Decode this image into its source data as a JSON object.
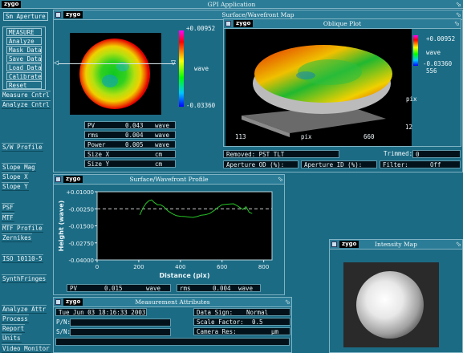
{
  "app": {
    "title": "GPI Application",
    "logo": "zygo",
    "aperture_btn": "Sm Aperture"
  },
  "measure_group": [
    "MEASURE",
    "Analyze",
    "Mask Data",
    "Save Data",
    "Load Data",
    "Calibrate",
    "Reset"
  ],
  "sidebar": {
    "group1": [
      "Measure Cntrl",
      "Analyze Cntrl"
    ],
    "group2": [
      "S/W Profile"
    ],
    "group3": [
      "Slope Mag",
      "Slope X",
      "Slope Y"
    ],
    "group4": [
      "PSF",
      "MTF",
      "MTF Profile",
      "Zernikes"
    ],
    "group5": [
      "ISO 10110-5"
    ],
    "group6": [
      "SynthFringes"
    ],
    "group7": [
      "Analyze Attr",
      "Process",
      "Report",
      "Units",
      "Video Monitor"
    ]
  },
  "surface_map": {
    "title": "Surface/Wavefront Map",
    "scale_max": "+0.00952",
    "scale_unit": "wave",
    "scale_min": "-0.03360",
    "stats": [
      {
        "label": "PV",
        "value": "0.043",
        "unit": "wave"
      },
      {
        "label": "rms",
        "value": "0.004",
        "unit": "wave"
      },
      {
        "label": "Power",
        "value": "0.005",
        "unit": "wave"
      },
      {
        "label": "Size X",
        "value": "",
        "unit": "cm"
      },
      {
        "label": "Size Y",
        "value": "",
        "unit": "cm"
      }
    ]
  },
  "oblique": {
    "title": "Oblique Plot",
    "scale_max": "+0.00952",
    "scale_unit": "wave",
    "scale_min": "-0.03360",
    "scale_extra": "556",
    "axis_y_label": "pix",
    "axis_x_label": "pix",
    "tick_12": "12",
    "tick_113": "113",
    "tick_660": "660",
    "removed": "Removed: PST TLT",
    "trimmed_label": "Trimmed:",
    "trimmed_value": "0",
    "aperture_od": "Aperture OD (%):",
    "aperture_id": "Aperture ID (%):",
    "filter_label": "Filter:",
    "filter_value": "Off"
  },
  "profile": {
    "title": "Surface/Wavefront Profile",
    "ylabel": "Height (wave)",
    "xlabel": "Distance (pix)",
    "pv_label": "PV",
    "pv_value": "0.015",
    "pv_unit": "wave",
    "rms_label": "rms",
    "rms_value": "0.004",
    "rms_unit": "wave"
  },
  "chart_data": {
    "type": "line",
    "title": "",
    "xlabel": "Distance (pix)",
    "ylabel": "Height (wave)",
    "xlim": [
      0,
      840
    ],
    "ylim": [
      -0.04,
      0.01
    ],
    "xticks": [
      0,
      200,
      400,
      600,
      800
    ],
    "yticks": [
      "+0.01000",
      "-0.00250",
      "-0.01500",
      "-0.02750",
      "-0.04000"
    ],
    "reference_line": -0.0025,
    "series": [
      {
        "x": [
          205,
          220,
          235,
          250,
          262,
          275,
          290,
          305,
          320,
          340,
          360,
          380,
          400,
          420,
          440,
          460,
          480,
          500,
          520,
          540,
          560,
          580,
          600,
          620,
          640,
          655,
          670,
          685,
          700,
          715,
          730,
          745
        ],
        "values": [
          -0.007,
          -0.002,
          0.0015,
          0.0035,
          0.004,
          0.002,
          0.0005,
          0.0005,
          -0.001,
          -0.004,
          -0.006,
          -0.0075,
          -0.008,
          -0.0082,
          -0.0085,
          -0.0088,
          -0.0082,
          -0.0072,
          -0.0068,
          -0.006,
          -0.004,
          -0.0015,
          0.0005,
          0.0008,
          0.001,
          0.0012,
          0.0,
          -0.0015,
          -0.003,
          -0.001,
          -0.005,
          -0.006
        ]
      }
    ]
  },
  "intensity": {
    "title": "Intensity Map"
  },
  "attributes": {
    "title": "Measurement Attributes",
    "timestamp": "Tue Jun 03 18:16:33 2003",
    "pn_label": "P/N:",
    "sn_label": "S/N:",
    "data_sign_label": "Data Sign:",
    "data_sign_value": "Normal",
    "scale_factor_label": "Scale Factor:",
    "scale_factor_value": "0.5",
    "camera_res_label": "Camera Res:",
    "camera_res_unit": "µm"
  },
  "colors": {
    "background": "#1c6b84",
    "plot_trace": "#26c426",
    "colorbar": [
      "#ff00ff",
      "#ff0000",
      "#ffff00",
      "#00ff00",
      "#00c8ff",
      "#0000ff"
    ]
  }
}
